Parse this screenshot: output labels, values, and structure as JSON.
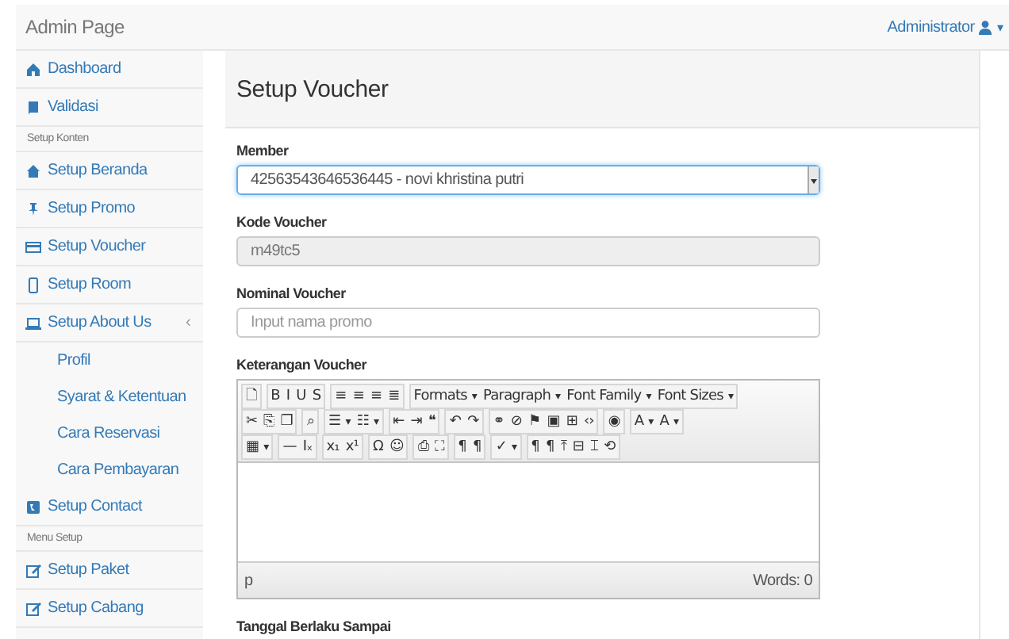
{
  "navbar": {
    "brand": "Admin Page",
    "user": "Administrator",
    "caret": "▾"
  },
  "sidebar": {
    "items": [
      {
        "kind": "link",
        "label": "Dashboard"
      },
      {
        "kind": "link",
        "label": "Validasi"
      },
      {
        "kind": "heading",
        "label": "Setup Konten"
      },
      {
        "kind": "link",
        "label": "Setup Beranda"
      },
      {
        "kind": "link",
        "label": "Setup Promo"
      },
      {
        "kind": "link",
        "label": "Setup Voucher"
      },
      {
        "kind": "link",
        "label": "Setup Room"
      },
      {
        "kind": "link",
        "label": "Setup About Us",
        "caret": "‹",
        "expanded": true,
        "children": [
          {
            "label": "Profil"
          },
          {
            "label": "Syarat & Ketentuan"
          },
          {
            "label": "Cara Reservasi"
          },
          {
            "label": "Cara Pembayaran"
          }
        ]
      },
      {
        "kind": "link",
        "label": "Setup Contact"
      },
      {
        "kind": "heading",
        "label": "Menu Setup"
      },
      {
        "kind": "link",
        "label": "Setup Paket"
      },
      {
        "kind": "link",
        "label": "Setup Cabang"
      }
    ]
  },
  "page": {
    "title": "Setup Voucher",
    "fields": [
      {
        "kind": "select",
        "label": "Member",
        "value": "42563543646536445 - novi khristina putri",
        "focused": true
      },
      {
        "kind": "readonly",
        "label": "Kode Voucher",
        "value": "m49tc5"
      },
      {
        "kind": "text",
        "label": "Nominal Voucher",
        "placeholder": "Input nama promo"
      },
      {
        "kind": "editor",
        "label": "Keterangan Voucher",
        "path": "p",
        "word_count": "Words: 0",
        "toolbar": [
          [
            [
              {
                "text": "🗋"
              }
            ],
            [
              {
                "text": "B"
              },
              {
                "text": "I"
              },
              {
                "text": "U"
              },
              {
                "text": "S"
              }
            ],
            [
              {
                "text": "≡"
              },
              {
                "text": "≡"
              },
              {
                "text": "≡"
              },
              {
                "text": "≣"
              }
            ],
            [
              {
                "text": "Formats",
                "caret": "▾"
              },
              {
                "text": "Paragraph",
                "caret": "▾"
              },
              {
                "text": "Font Family",
                "caret": "▾"
              },
              {
                "text": "Font Sizes",
                "caret": "▾"
              }
            ]
          ],
          [
            [
              {
                "text": "✂"
              },
              {
                "text": "⎘"
              },
              {
                "text": "❐"
              }
            ],
            [
              {
                "text": "⌕"
              }
            ],
            [
              {
                "text": "☰",
                "caret": "▾"
              },
              {
                "text": "☷",
                "caret": "▾"
              }
            ],
            [
              {
                "text": "⇤"
              },
              {
                "text": "⇥"
              },
              {
                "text": "❝"
              }
            ],
            [
              {
                "text": "↶"
              },
              {
                "text": "↷"
              }
            ],
            [
              {
                "text": "⚭"
              },
              {
                "text": "⊘"
              },
              {
                "text": "⚑"
              },
              {
                "text": "▣"
              },
              {
                "text": "⊞"
              },
              {
                "text": "‹›"
              }
            ],
            [
              {
                "text": "◉"
              }
            ],
            [
              {
                "text": "A",
                "caret": "▾"
              },
              {
                "text": "A",
                "caret": "▾"
              }
            ]
          ],
          [
            [
              {
                "text": "▦",
                "caret": "▾"
              }
            ],
            [
              {
                "text": "—"
              },
              {
                "text": "Iₓ"
              }
            ],
            [
              {
                "text": "x₁"
              },
              {
                "text": "x¹"
              }
            ],
            [
              {
                "text": "Ω"
              },
              {
                "text": "☺"
              }
            ],
            [
              {
                "text": "⎙"
              },
              {
                "text": "⛶"
              }
            ],
            [
              {
                "text": "¶"
              },
              {
                "text": "¶"
              }
            ],
            [
              {
                "text": "✓",
                "caret": "▾"
              }
            ],
            [
              {
                "text": "¶"
              },
              {
                "text": "¶"
              },
              {
                "text": "⤒"
              },
              {
                "text": "⊟"
              },
              {
                "text": "⌶"
              },
              {
                "text": "⟲"
              }
            ]
          ]
        ]
      },
      {
        "kind": "date",
        "label": "Tanggal Berlaku Sampai"
      }
    ]
  }
}
